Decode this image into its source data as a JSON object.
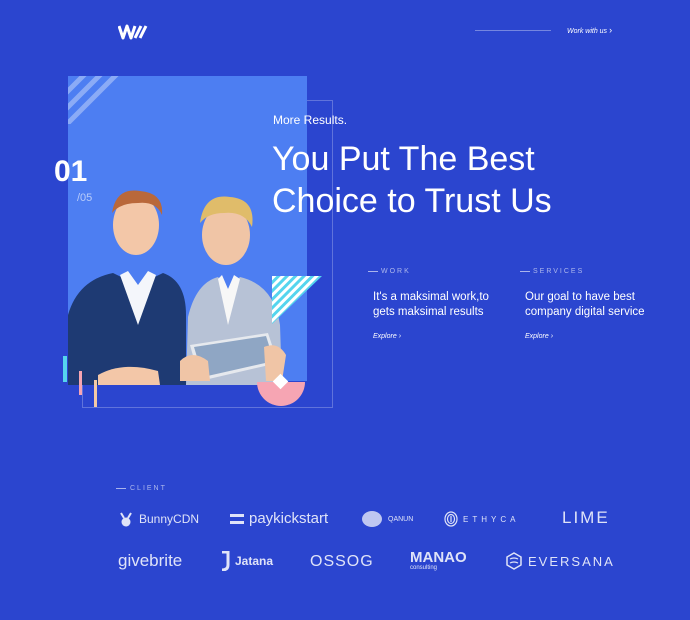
{
  "header": {
    "logo_icon": "brand-w-mark-icon",
    "nav_link": "Work with us"
  },
  "hero": {
    "slide_current": "01",
    "slide_total": "/05",
    "eyebrow": "More Results.",
    "headline_line1": "You Put The Best",
    "headline_line2": "Choice to Trust Us"
  },
  "features": [
    {
      "label": "WORK",
      "text_line1": "It's a maksimal work,to",
      "text_line2": "gets maksimal results",
      "link": "Explore"
    },
    {
      "label": "SERVICES",
      "text_line1": "Our goal to have best",
      "text_line2": "company digital service",
      "link": "Explore"
    }
  ],
  "clients": {
    "label": "CLIENT",
    "logos": [
      "BunnyCDN",
      "paykickstart",
      "QANUN",
      "ETHYCA",
      "LIME",
      "givebrite",
      "Jatana",
      "OSSOG",
      "MANAO",
      "consulting",
      "EVERSANA"
    ]
  },
  "colors": {
    "background": "#2b45cf",
    "card": "#4d7ef2",
    "accent_cyan": "#55d5ee",
    "accent_pink": "#f6a5b3"
  }
}
